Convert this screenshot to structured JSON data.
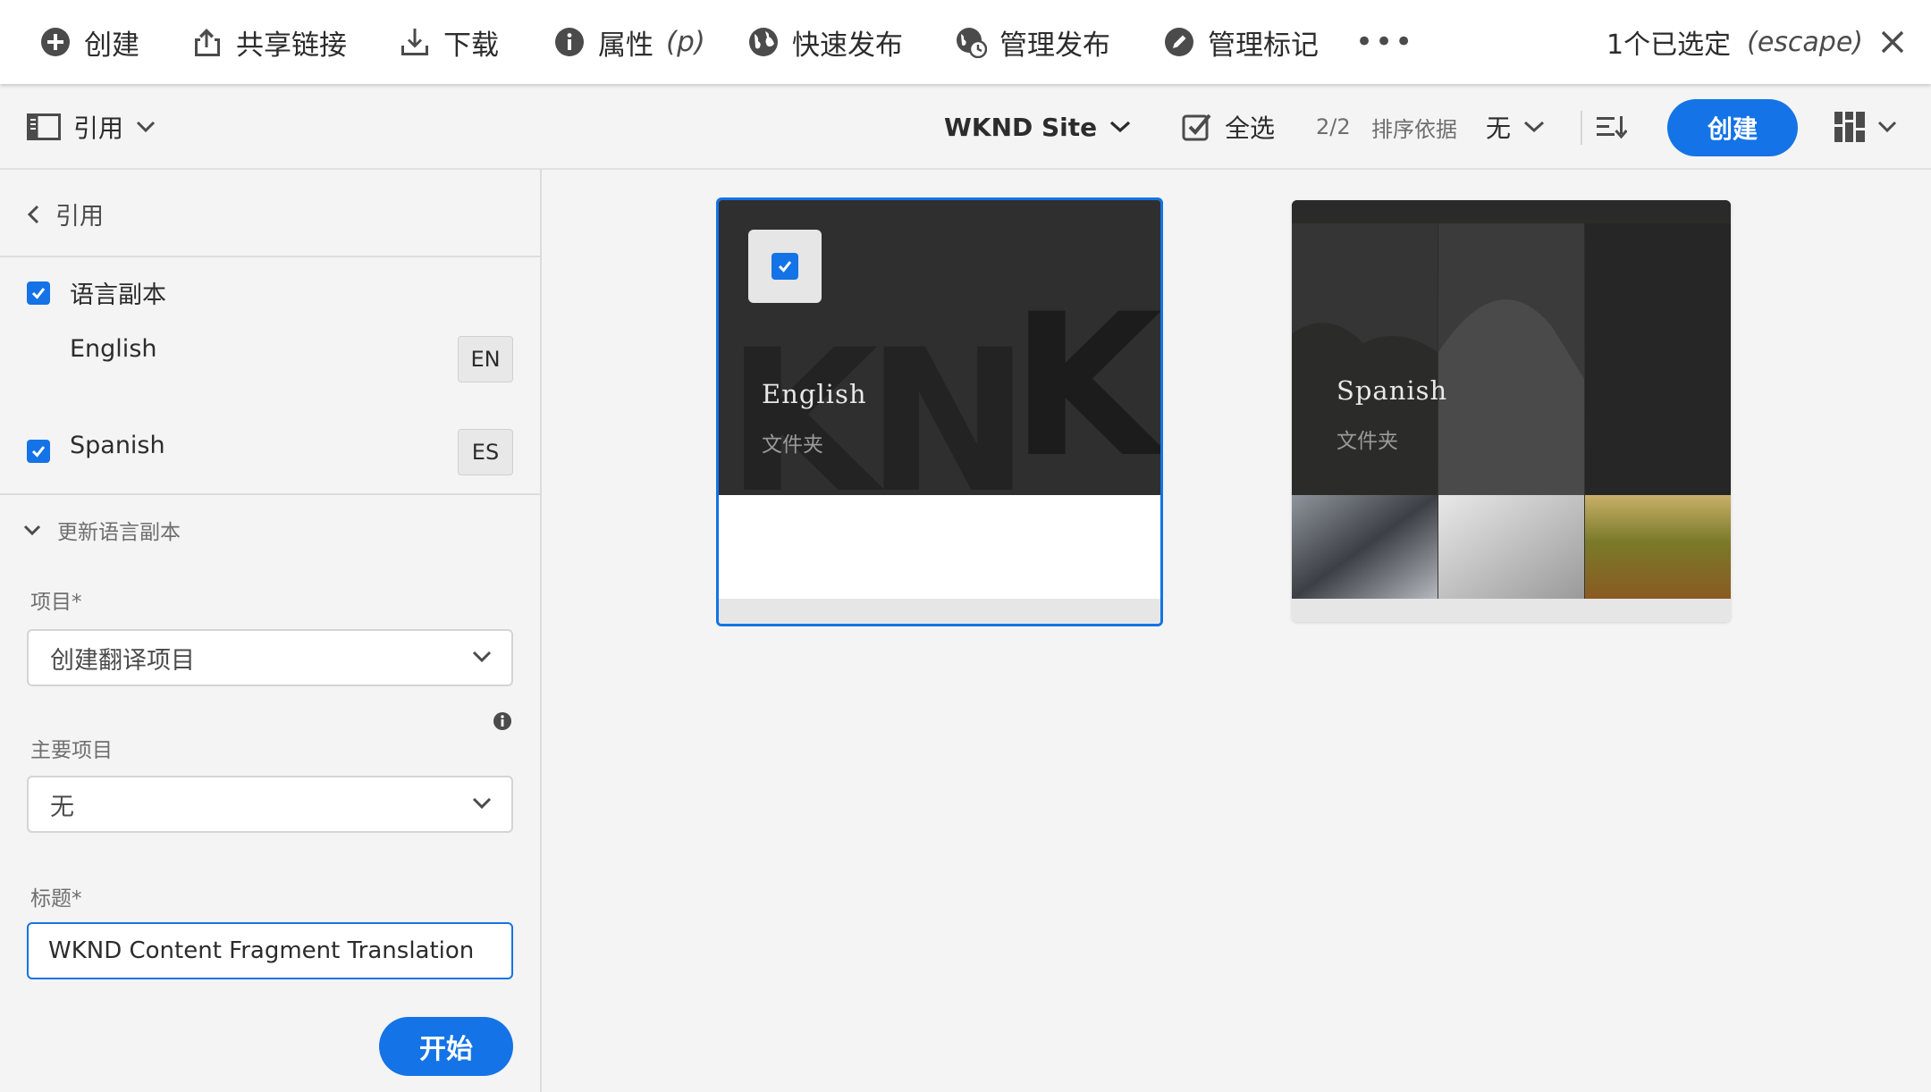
{
  "actionbar": {
    "create": "创建",
    "share_link": "共享链接",
    "download": "下载",
    "properties": "属性",
    "properties_shortcut": "(p)",
    "quick_publish": "快速发布",
    "manage_publication": "管理发布",
    "manage_tags": "管理标记",
    "more": "•••",
    "selection_count": "1个已选定",
    "selection_shortcut": "(escape)"
  },
  "toolbar": {
    "rail_toggle_label": "引用",
    "site": "WKND Site",
    "select_all": "全选",
    "count": "2/2",
    "sort_by": "排序依据",
    "sort_value": "无",
    "create": "创建"
  },
  "rail": {
    "back_label": "引用",
    "language_copies": "语言副本",
    "languages": [
      {
        "name": "English",
        "code": "EN"
      },
      {
        "name": "Spanish",
        "code": "ES"
      }
    ],
    "update_section": "更新语言副本",
    "project_label": "项目*",
    "project_value": "创建翻译项目",
    "master_project_label": "主要项目",
    "master_project_value": "无",
    "title_label": "标题*",
    "title_value": "WKND Content Fragment Translation",
    "start": "开始"
  },
  "cards": [
    {
      "title": "English",
      "type": "文件夹",
      "thumb_text": "KN",
      "selected": true
    },
    {
      "title": "Spanish",
      "type": "文件夹",
      "selected": false
    }
  ],
  "colors": {
    "accent": "#1473e6",
    "background": "#f4f4f4"
  }
}
